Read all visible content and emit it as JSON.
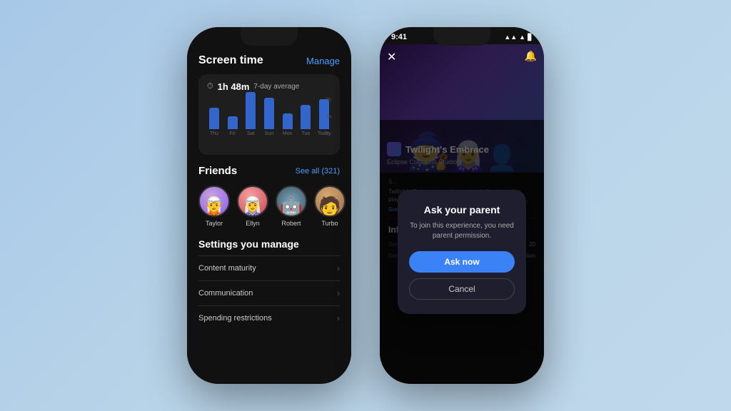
{
  "left_phone": {
    "screen_time": {
      "title": "Screen time",
      "manage_label": "Manage",
      "stats": {
        "icon": "⏱",
        "time": "1h 48m",
        "label": "7-day average"
      },
      "chart": {
        "y_labels": [
          "2h",
          "1h",
          "0"
        ],
        "bars": [
          {
            "label": "Thu",
            "height": 30
          },
          {
            "label": "Fri",
            "height": 20
          },
          {
            "label": "Sat",
            "height": 65
          },
          {
            "label": "Sun",
            "height": 55
          },
          {
            "label": "Mon",
            "height": 25
          },
          {
            "label": "Tue",
            "height": 40
          },
          {
            "label": "Today",
            "height": 50
          }
        ]
      }
    },
    "friends": {
      "title": "Friends",
      "see_all_label": "See all (321)",
      "list": [
        {
          "name": "Taylor",
          "color": "#8b5cf6"
        },
        {
          "name": "Ellyn",
          "color": "#c45"
        },
        {
          "name": "Robert",
          "color": "#7ab"
        },
        {
          "name": "Turbo",
          "color": "#d4a870"
        }
      ]
    },
    "settings": {
      "title": "Settings you manage",
      "items": [
        {
          "label": "Content maturity"
        },
        {
          "label": "Communication"
        },
        {
          "label": "Spending restrictions"
        }
      ]
    }
  },
  "right_phone": {
    "status_bar": {
      "time": "9:41",
      "icons": "▲ ▲ ▊"
    },
    "game": {
      "name": "Twilight's Embrace",
      "studio": "Eclipse Creations Studio",
      "verified": "✓",
      "description": "Twilight's Embrace is an immersive thriller that takes players on a journey through shadowed landscapes a...",
      "see_more": "See more"
    },
    "modal": {
      "title": "Ask your parent",
      "description": "To join this experience, you need parent permission.",
      "ask_now_label": "Ask now",
      "cancel_label": "Cancel"
    },
    "information": {
      "title": "Information",
      "rows": [
        {
          "key": "Server Size",
          "value": "20"
        },
        {
          "key": "Genre",
          "value": "Action"
        }
      ]
    }
  }
}
